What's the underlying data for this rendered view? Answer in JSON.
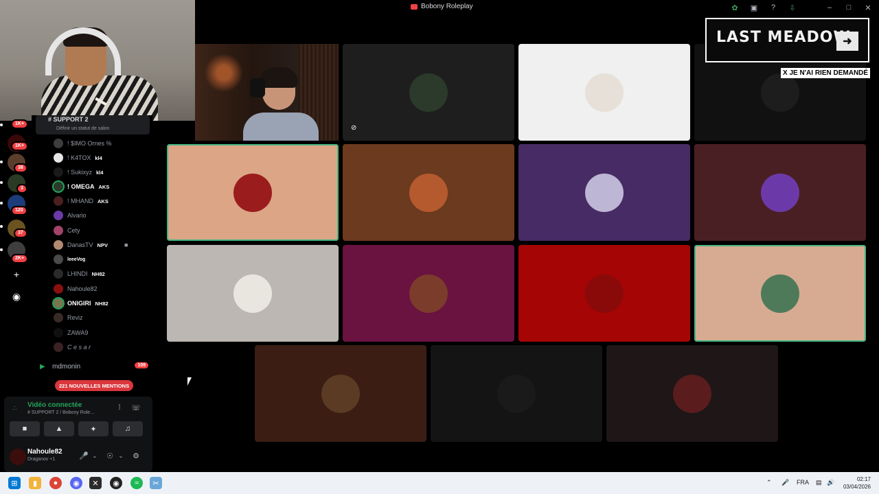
{
  "window": {
    "title": "Bobony Roleplay"
  },
  "overlay": {
    "title": "LAST MEADOW",
    "note": "X JE N'AI RIEN DEMANDÉ",
    "arrow_icon": "arrow-right-icon"
  },
  "rail_badges": [
    "1K+",
    "1K+",
    "38",
    "3",
    "120",
    "37",
    "2K+"
  ],
  "channel_top": {
    "name": "# SUPPORT 2",
    "status": "Définir un statut de salon"
  },
  "members": [
    {
      "name": "! $IMO Ornes %",
      "tag": ""
    },
    {
      "name": "! K4TOX",
      "tag": "kl4"
    },
    {
      "name": "! Sukixyz",
      "tag": "kl4"
    },
    {
      "name": "! OMEGA",
      "tag": "AKS"
    },
    {
      "name": "! MHAND",
      "tag": "AKS"
    },
    {
      "name": "Alvario",
      "tag": ""
    },
    {
      "name": "Cety",
      "tag": ""
    },
    {
      "name": "DanasTV",
      "tag": "NPV"
    },
    {
      "name": "leeeVog",
      "tag": ""
    },
    {
      "name": "LHINDI",
      "tag": "NH82"
    },
    {
      "name": "Nahoule82",
      "tag": ""
    },
    {
      "name": "ONIGIRI",
      "tag": "NH82"
    },
    {
      "name": "Reviz",
      "tag": ""
    },
    {
      "name": "ZAWA9",
      "tag": ""
    },
    {
      "name": "C e s a r",
      "tag": ""
    }
  ],
  "mdmonin": {
    "label": "mdmonin",
    "badge": "109"
  },
  "mentions": "221 NOUVELLES MENTIONS",
  "voice": {
    "status": "Vidéo connectée",
    "channel": "# SUPPORT 2 / Bobony Role..."
  },
  "user": {
    "name": "Nahoule82",
    "status": "Draganov +1"
  },
  "tiles": [
    {
      "color": "#1e1e1e",
      "avatar_color": "#2b3a2a"
    },
    {
      "color": "#f0f0f0",
      "avatar_color": "#e6e0d8"
    },
    {
      "color": "#111111",
      "avatar_color": "#1d1d1d"
    },
    {
      "color": "#dba586",
      "avatar_color": "#9b1c1c"
    },
    {
      "color": "#6b3a1f",
      "avatar_color": "#b55a2e"
    },
    {
      "color": "#472b64",
      "avatar_color": "#bdb6d4"
    },
    {
      "color": "#4a1f24",
      "avatar_color": "#6c3aa8"
    },
    {
      "color": "#bcb7b2",
      "avatar_color": "#e9e6e0"
    },
    {
      "color": "#6a1240",
      "avatar_color": "#7b3c2c"
    },
    {
      "color": "#a50505",
      "avatar_color": "#8a0a0a"
    },
    {
      "color": "#d7ab92",
      "avatar_color": "#4f7a5a"
    },
    {
      "color": "#3b1d14",
      "avatar_color": "#5b3b23"
    },
    {
      "color": "#141414",
      "avatar_color": "#1a1a1a"
    },
    {
      "color": "#1e1617",
      "avatar_color": "#5a1c1c"
    }
  ],
  "taskbar": {
    "lang": "FRA",
    "time": "02:17",
    "date": "03/04/2026"
  }
}
